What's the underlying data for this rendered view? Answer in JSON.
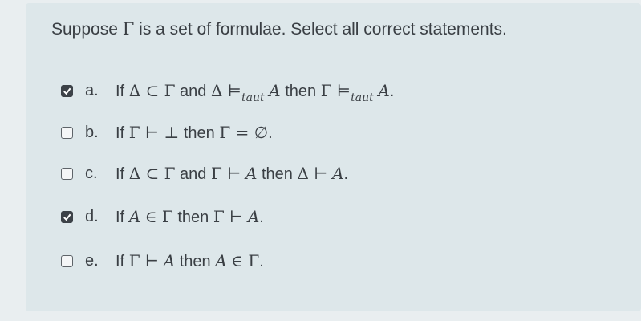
{
  "question": {
    "pre": "Suppose",
    "gamma": "Γ",
    "post": "is a set of formulae.  Select all correct statements."
  },
  "options": [
    {
      "letter": "a.",
      "checked": true,
      "parts": [
        "If",
        "Δ ⊂ Γ",
        "and",
        "Δ ⊨",
        "taut",
        "A",
        "then",
        "Γ ⊨",
        "taut",
        "A",
        "."
      ]
    },
    {
      "letter": "b.",
      "checked": false,
      "parts": [
        "If",
        "Γ ⊢ ⊥",
        "then",
        "Γ = ∅",
        "."
      ]
    },
    {
      "letter": "c.",
      "checked": false,
      "parts": [
        "If",
        "Δ ⊂ Γ",
        "and",
        "Γ ⊢",
        "A",
        "then",
        "Δ ⊢",
        "A",
        "."
      ]
    },
    {
      "letter": "d.",
      "checked": true,
      "parts": [
        "If",
        "A",
        "∈ Γ",
        "then",
        "Γ ⊢",
        "A",
        "."
      ]
    },
    {
      "letter": "e.",
      "checked": false,
      "parts": [
        "If",
        "Γ ⊢",
        "A",
        "then",
        "A",
        "∈ Γ",
        "."
      ]
    }
  ]
}
